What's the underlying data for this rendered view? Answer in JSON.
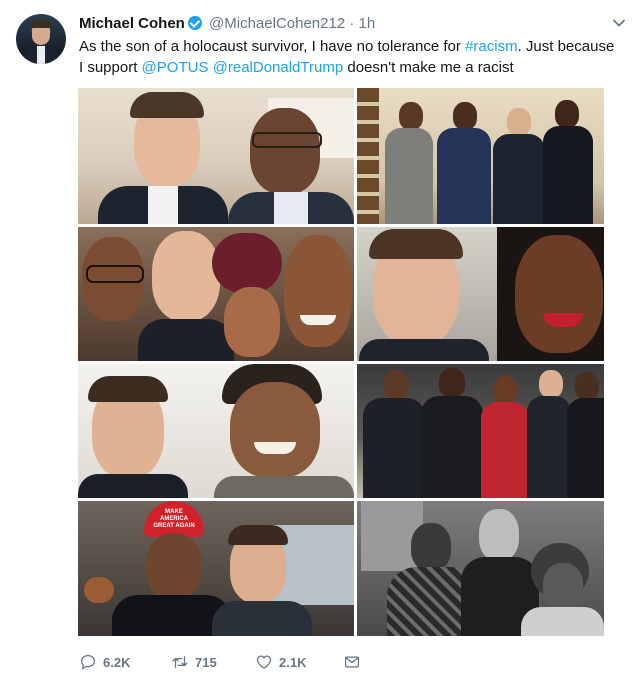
{
  "tweet": {
    "author_name": "Michael Cohen",
    "handle": "@MichaelCohen212",
    "separator": "·",
    "time": "1h",
    "text_parts": {
      "p1": "As the son of a holocaust survivor, I have no tolerance for ",
      "hashtag": "#racism",
      "p2": ". Just because I support ",
      "mention1": "@POTUS",
      "p3": " ",
      "mention2": "@realDonaldTrump",
      "p4": " doesn't make me a racist"
    },
    "hat_text": "MAKE AMERICA GREAT AGAIN"
  },
  "actions": {
    "replies": "6.2K",
    "retweets": "715",
    "likes": "2.1K"
  },
  "icons": [
    "verified-badge-icon",
    "chevron-down-icon",
    "reply-icon",
    "retweet-icon",
    "like-icon",
    "message-icon"
  ],
  "colors": {
    "accent": "#1da1f2",
    "muted": "#657786",
    "text": "#14171a"
  }
}
